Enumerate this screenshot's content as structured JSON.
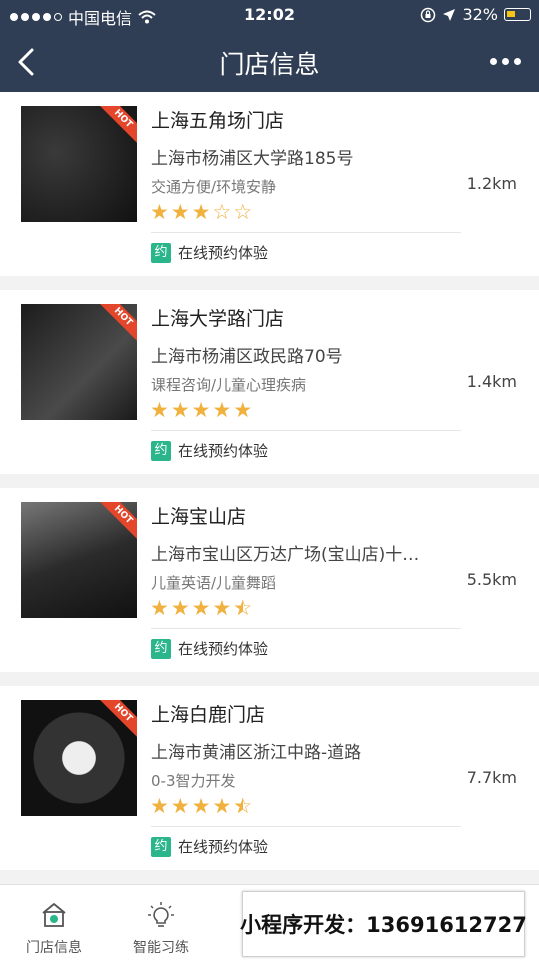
{
  "status_bar": {
    "carrier": "中国电信",
    "time": "12:02",
    "battery_percent": "32%"
  },
  "nav": {
    "title": "门店信息"
  },
  "stores": [
    {
      "name": "上海五角场门店",
      "address": "上海市杨浦区大学路185号",
      "tags": "交通方便/环境安静",
      "distance": "1.2km",
      "rating": 3,
      "hot_label": "HOT",
      "book_badge": "约",
      "book_label": "在线预约体验"
    },
    {
      "name": "上海大学路门店",
      "address": "上海市杨浦区政民路70号",
      "tags": "课程咨询/儿童心理疾病",
      "distance": "1.4km",
      "rating": 5,
      "hot_label": "HOT",
      "book_badge": "约",
      "book_label": "在线预约体验"
    },
    {
      "name": "上海宝山店",
      "address": "上海市宝山区万达广场(宝山店)十…",
      "tags": "儿童英语/儿童舞蹈",
      "distance": "5.5km",
      "rating": 4.5,
      "hot_label": "HOT",
      "book_badge": "约",
      "book_label": "在线预约体验"
    },
    {
      "name": "上海白鹿门店",
      "address": "上海市黄浦区浙江中路-道路",
      "tags": "0-3智力开发",
      "distance": "7.7km",
      "rating": 4.5,
      "hot_label": "HOT",
      "book_badge": "约",
      "book_label": "在线预约体验"
    }
  ],
  "tabbar": {
    "tabs": [
      {
        "label": "门店信息",
        "icon": "store-icon"
      },
      {
        "label": "智能习练",
        "icon": "lightbulb-icon"
      }
    ]
  },
  "promo": {
    "text": "小程序开发：13691612727"
  },
  "colors": {
    "header_bg": "#2f3e54",
    "star": "#f0b13e",
    "book_badge": "#2ab58a",
    "hot": "#e3462a",
    "battery": "#f4c515"
  }
}
